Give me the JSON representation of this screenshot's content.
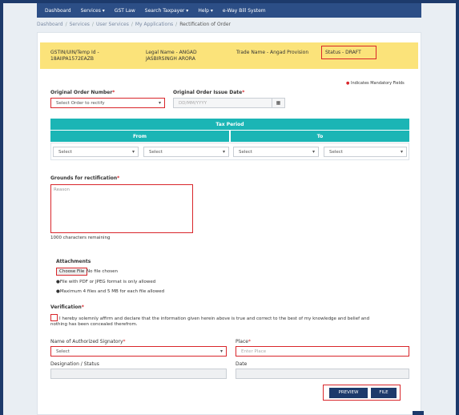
{
  "nav": {
    "items": [
      "Dashboard",
      "Services ▾",
      "GST Law",
      "Search Taxpayer ▾",
      "Help ▾",
      "e-Way Bill System"
    ]
  },
  "breadcrumb": [
    "Dashboard",
    "Services",
    "User Services",
    "My Applications",
    "Rectification of Order"
  ],
  "taxpayer": {
    "gstin_label": "GSTIN/UIN/Temp Id -",
    "gstin_value": "18AIIPA1572EAZB",
    "legal_name_label": "Legal Name - ANGAD",
    "legal_name_value": "JASBIRSINGH ARORA",
    "trade_name": "Trade Name - Angad Provision",
    "status": "Status - DRAFT"
  },
  "mandatory_note": "Indicates Mandatory Fields",
  "order": {
    "number_label": "Original Order Number",
    "number_placeholder": "Select Order to rectify",
    "date_label": "Original Order Issue Date",
    "date_placeholder": "DD/MM/YYYY"
  },
  "tax_period": {
    "header": "Tax Period",
    "from": "From",
    "to": "To",
    "selects": [
      "Select",
      "Select",
      "Select",
      "Select"
    ]
  },
  "grounds": {
    "label": "Grounds for rectification",
    "placeholder": "Reason",
    "remaining": "1000 characters remaining"
  },
  "attachments": {
    "title": "Attachments",
    "choose_button": "Choose File",
    "no_file": "No file chosen",
    "note1": "File with PDF or JPEG format is only allowed",
    "note2": "Maximum 4 files and 5 MB for each file allowed"
  },
  "verification": {
    "title": "Verification",
    "text_line1": "I hereby solemnly affirm and declare that the information given herein above is true and correct to the best of my knowledge and belief and",
    "text_line2": "nothing has been concealed therefrom."
  },
  "signatory": {
    "label": "Name of Authorized Signatory",
    "placeholder": "Select",
    "designation_label": "Designation / Status"
  },
  "place": {
    "label": "Place",
    "placeholder": "Enter Place",
    "date_label": "Date"
  },
  "actions": {
    "preview": "PREVIEW",
    "file": "FILE"
  },
  "colors": {
    "nav": "#2c4e86",
    "teal": "#1bb5b5",
    "highlight": "#fbe37a",
    "error_outline": "#d9262b"
  }
}
